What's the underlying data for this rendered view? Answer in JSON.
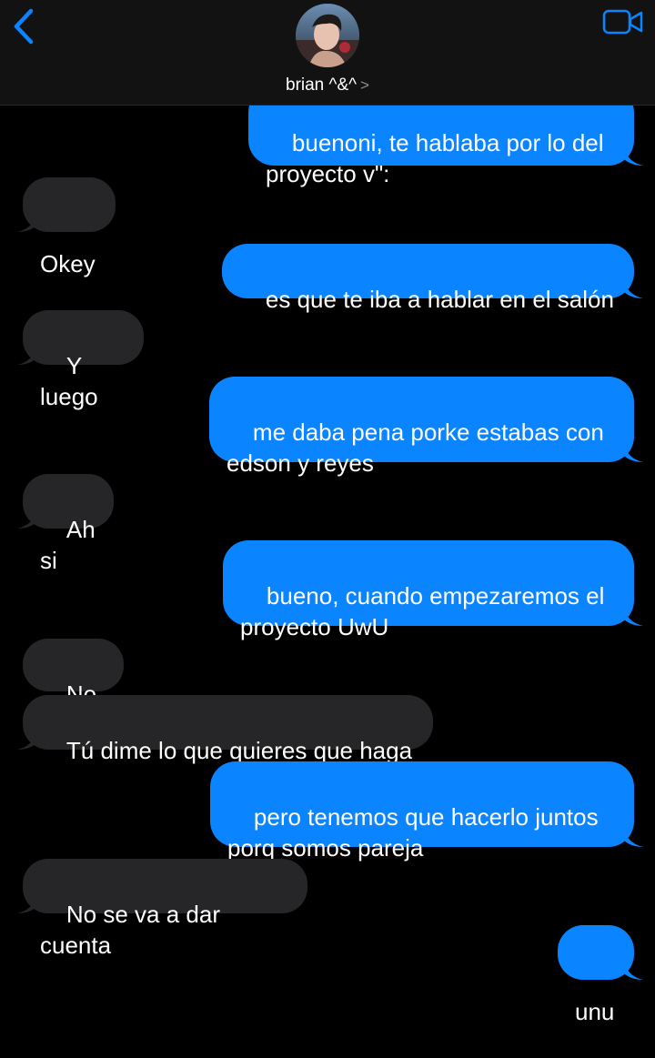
{
  "header": {
    "back_icon": "chevron-left-icon",
    "video_icon": "video-camera-icon",
    "contact_name": "brian ^&^",
    "contact_chevron": ">",
    "accent_color": "#0a84ff"
  },
  "messages": [
    {
      "from": "me",
      "text": "buenoni, te hablaba por lo del\nproyecto v\":"
    },
    {
      "from": "them",
      "text": "Okey"
    },
    {
      "from": "me",
      "text": "es que te iba a hablar en el salón"
    },
    {
      "from": "them",
      "text": "Y luego"
    },
    {
      "from": "me",
      "text": "me daba pena porke estabas con\nedson y reyes"
    },
    {
      "from": "them",
      "text": "Ah si"
    },
    {
      "from": "me",
      "text": "bueno, cuando empezaremos el\nproyecto UwU"
    },
    {
      "from": "them",
      "text": "No sé"
    },
    {
      "from": "them",
      "text": "Tú dime lo que quieres que haga"
    },
    {
      "from": "me",
      "text": "pero tenemos que hacerlo juntos\nporq somos pareja"
    },
    {
      "from": "them",
      "text": "No se va a dar cuenta"
    },
    {
      "from": "me",
      "text": "unu"
    }
  ],
  "colors": {
    "sent_bubble": "#0a84ff",
    "received_bubble": "#262628",
    "background": "#000000"
  }
}
